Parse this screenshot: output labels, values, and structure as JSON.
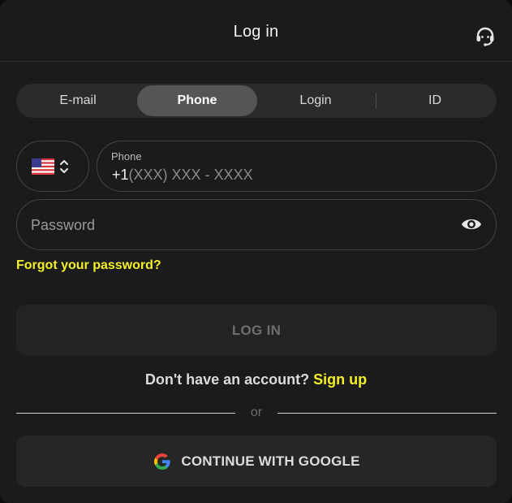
{
  "header": {
    "title": "Log in",
    "support_icon": "headset-icon"
  },
  "tabs": [
    {
      "label": "E-mail",
      "active": false
    },
    {
      "label": "Phone",
      "active": true
    },
    {
      "label": "Login",
      "active": false
    },
    {
      "label": "ID",
      "active": false
    }
  ],
  "phone": {
    "country_flag": "us-flag-icon",
    "label": "Phone",
    "prefix": "+1",
    "placeholder": "(XXX) XXX - XXXX"
  },
  "password": {
    "placeholder": "Password",
    "toggle_icon": "eye-icon"
  },
  "forgot_password": "Forgot your password?",
  "login_button": "LOG IN",
  "signup": {
    "prompt": "Don't have an account?",
    "link": "Sign up"
  },
  "divider": "or",
  "google_button": "CONTINUE WITH GOOGLE",
  "colors": {
    "accent_yellow": "#f4f027",
    "background": "#1b1b1b",
    "active_tab": "#555555"
  }
}
